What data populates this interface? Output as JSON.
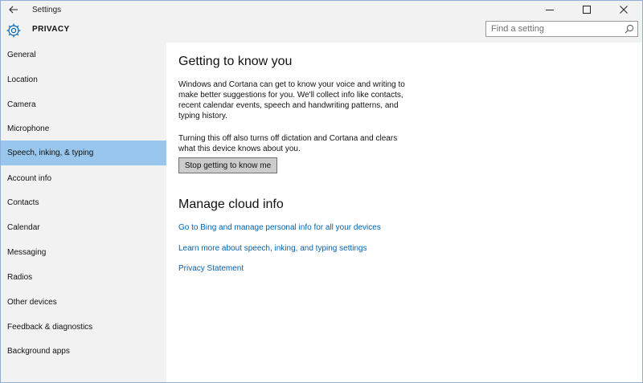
{
  "window": {
    "title": "Settings",
    "controls": [
      "minimize",
      "maximize",
      "close"
    ]
  },
  "header": {
    "icon": "gear-icon",
    "title": "PRIVACY"
  },
  "search": {
    "placeholder": "Find a setting",
    "value": ""
  },
  "sidebar": {
    "selected": "Speech, inking, & typing",
    "items": [
      {
        "label": "General"
      },
      {
        "label": "Location"
      },
      {
        "label": "Camera"
      },
      {
        "label": "Microphone"
      },
      {
        "label": "Speech, inking, & typing"
      },
      {
        "label": "Account info"
      },
      {
        "label": "Contacts"
      },
      {
        "label": "Calendar"
      },
      {
        "label": "Messaging"
      },
      {
        "label": "Radios"
      },
      {
        "label": "Other devices"
      },
      {
        "label": "Feedback & diagnostics"
      },
      {
        "label": "Background apps"
      }
    ]
  },
  "main": {
    "getting_to_know": {
      "heading": "Getting to know you",
      "paragraph1": "Windows and Cortana can get to know your voice and writing to make better suggestions for you. We'll collect info like contacts, recent calendar events, speech and handwriting patterns, and typing history.",
      "paragraph2": "Turning this off also turns off dictation and Cortana and clears what this device knows about you.",
      "button_label": "Stop getting to know me"
    },
    "cloud": {
      "heading": "Manage cloud info",
      "links": [
        {
          "label": "Go to Bing and manage personal info for all your devices"
        },
        {
          "label": "Learn more about speech, inking, and typing settings"
        },
        {
          "label": "Privacy Statement"
        }
      ]
    }
  },
  "colors": {
    "accent": "#0063b1",
    "selected_background": "#99c6ec",
    "sidebar_background": "#f2f2f2",
    "button_background": "#cccccc"
  }
}
